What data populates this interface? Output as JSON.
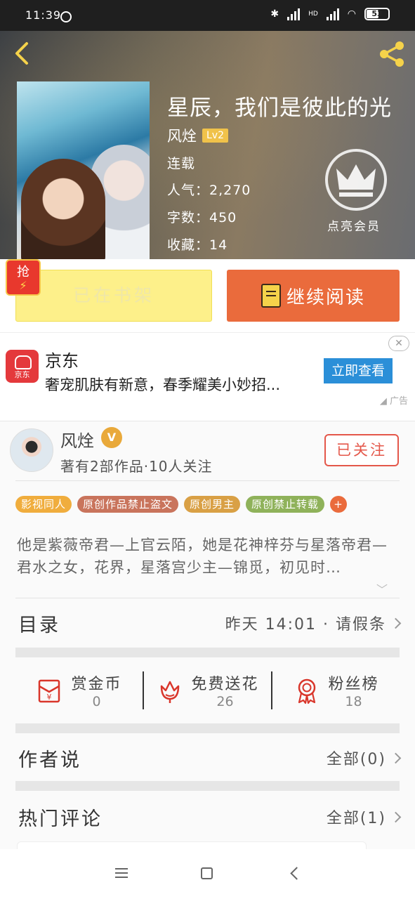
{
  "status_bar": {
    "time": "11:39",
    "battery": "53",
    "network": "HD"
  },
  "book": {
    "title": "星辰，我们是彼此的光",
    "author": "风烇",
    "level": "Lv2",
    "status": "连载",
    "popularity": "人气：2,270",
    "word_count": "字数：450",
    "favorites": "收藏：14",
    "membership_label": "点亮会员"
  },
  "actions": {
    "grab_badge": "抢",
    "shelf_label": "已在书架",
    "read_label": "继续阅读"
  },
  "ad": {
    "logo_text": "京东",
    "title": "京东",
    "description": "奢宠肌肤有新意，春季耀美小妙招...",
    "button": "立即查看",
    "close": "✕",
    "label": "广告"
  },
  "author_card": {
    "name": "风烇",
    "badge": "V",
    "stats": "著有2部作品·10人关注",
    "follow_label": "已关注"
  },
  "tags": [
    {
      "label": "影视同人",
      "color": "#f0ad3d"
    },
    {
      "label": "原创作品禁止盗文",
      "color": "#c9745c"
    },
    {
      "label": "原创男主",
      "color": "#d9a045"
    },
    {
      "label": "原创禁止转载",
      "color": "#8fb25a"
    }
  ],
  "tag_more": "+",
  "summary": "他是紫薇帝君—上官云陌，她是花神梓芬与星落帝君—君水之女，花界，星落宫少主—锦觅，初见时…",
  "toc": {
    "label": "目录",
    "latest": "昨天 14:01 · 请假条"
  },
  "stats": [
    {
      "label": "赏金币",
      "value": "0",
      "icon": "red-envelope-icon"
    },
    {
      "label": "免费送花",
      "value": "26",
      "icon": "flower-icon"
    },
    {
      "label": "粉丝榜",
      "value": "18",
      "icon": "medal-icon"
    }
  ],
  "author_says": {
    "label": "作者说",
    "link": "全部(0)"
  },
  "hot_comments": {
    "label": "热门评论",
    "link": "全部(1)"
  }
}
